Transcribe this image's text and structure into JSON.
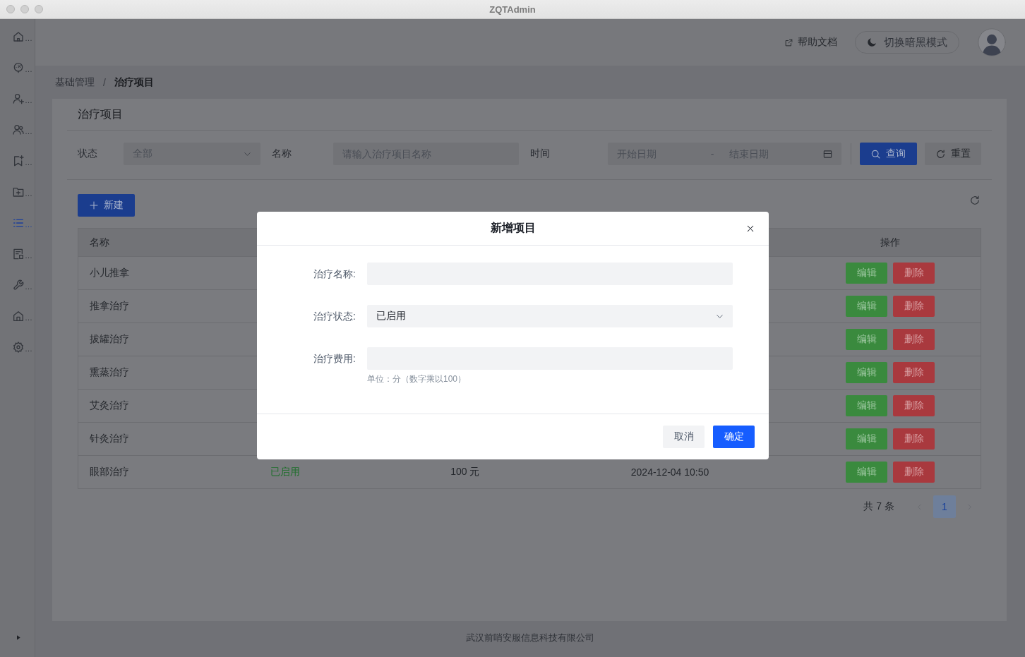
{
  "window": {
    "title": "ZQTAdmin"
  },
  "sidebar": {
    "items": [
      {
        "label": "…",
        "selected": false
      },
      {
        "label": "…",
        "selected": false
      },
      {
        "label": "…",
        "selected": false
      },
      {
        "label": "…",
        "selected": false
      },
      {
        "label": "…",
        "selected": false
      },
      {
        "label": "…",
        "selected": false
      },
      {
        "label": "…",
        "selected": true
      },
      {
        "label": "…",
        "selected": false
      },
      {
        "label": "…",
        "selected": false
      },
      {
        "label": "…",
        "selected": false
      },
      {
        "label": "…",
        "selected": false
      }
    ]
  },
  "header": {
    "help_link": "帮助文档",
    "theme_toggle": "切换暗黑模式"
  },
  "breadcrumb": {
    "items": [
      "基础管理",
      "治疗项目"
    ],
    "separator": "/"
  },
  "card": {
    "title": "治疗项目",
    "filters": [
      {
        "kind": "select",
        "label": "状态",
        "placeholder": "全部"
      },
      {
        "kind": "input",
        "label": "名称",
        "placeholder": "请输入治疗项目名称"
      },
      {
        "kind": "date_range",
        "label": "时间",
        "start_placeholder": "开始日期",
        "separator": "-",
        "end_placeholder": "结束日期"
      }
    ],
    "filter_buttons": [
      {
        "kind": "primary",
        "label": "查询"
      },
      {
        "kind": "default",
        "label": "重置"
      }
    ],
    "new_button": "新建",
    "table": {
      "header": {
        "name": "名称",
        "actions": "操作"
      },
      "rows": [
        {
          "name": "小儿推拿",
          "actions": [
            {
              "kind": "success",
              "label": "编辑"
            },
            {
              "kind": "danger",
              "label": "删除"
            }
          ]
        },
        {
          "name": "推拿治疗",
          "actions": [
            {
              "kind": "success",
              "label": "编辑"
            },
            {
              "kind": "danger",
              "label": "删除"
            }
          ]
        },
        {
          "name": "拔罐治疗",
          "actions": [
            {
              "kind": "success",
              "label": "编辑"
            },
            {
              "kind": "danger",
              "label": "删除"
            }
          ]
        },
        {
          "name": "熏蒸治疗",
          "actions": [
            {
              "kind": "success",
              "label": "编辑"
            },
            {
              "kind": "danger",
              "label": "删除"
            }
          ]
        },
        {
          "name": "艾灸治疗",
          "actions": [
            {
              "kind": "success",
              "label": "编辑"
            },
            {
              "kind": "danger",
              "label": "删除"
            }
          ]
        },
        {
          "name": "针灸治疗",
          "actions": [
            {
              "kind": "success",
              "label": "编辑"
            },
            {
              "kind": "danger",
              "label": "删除"
            }
          ]
        },
        {
          "name": "眼部治疗",
          "column_2": "已启用",
          "column_3": "100 元",
          "column_4": "2024-12-04 10:50",
          "actions": [
            {
              "kind": "success",
              "label": "编辑"
            },
            {
              "kind": "danger",
              "label": "删除"
            }
          ]
        }
      ]
    },
    "pagination": {
      "total": "共 7 条",
      "prev_disabled": true,
      "pages": [
        {
          "label": "1",
          "selected": true
        }
      ],
      "next_disabled": true
    }
  },
  "footer": "武汉前哨安服信息科技有限公司",
  "modal": {
    "title": "新增项目",
    "fields": [
      {
        "kind": "input",
        "label": "治疗名称:"
      },
      {
        "kind": "select",
        "label": "治疗状态:",
        "value": "已启用"
      },
      {
        "kind": "input",
        "label": "治疗费用:",
        "hint": "单位：分（数字乘以100）"
      }
    ],
    "buttons": [
      {
        "kind": "default",
        "label": "取消"
      },
      {
        "kind": "primary",
        "label": "确定"
      }
    ]
  }
}
